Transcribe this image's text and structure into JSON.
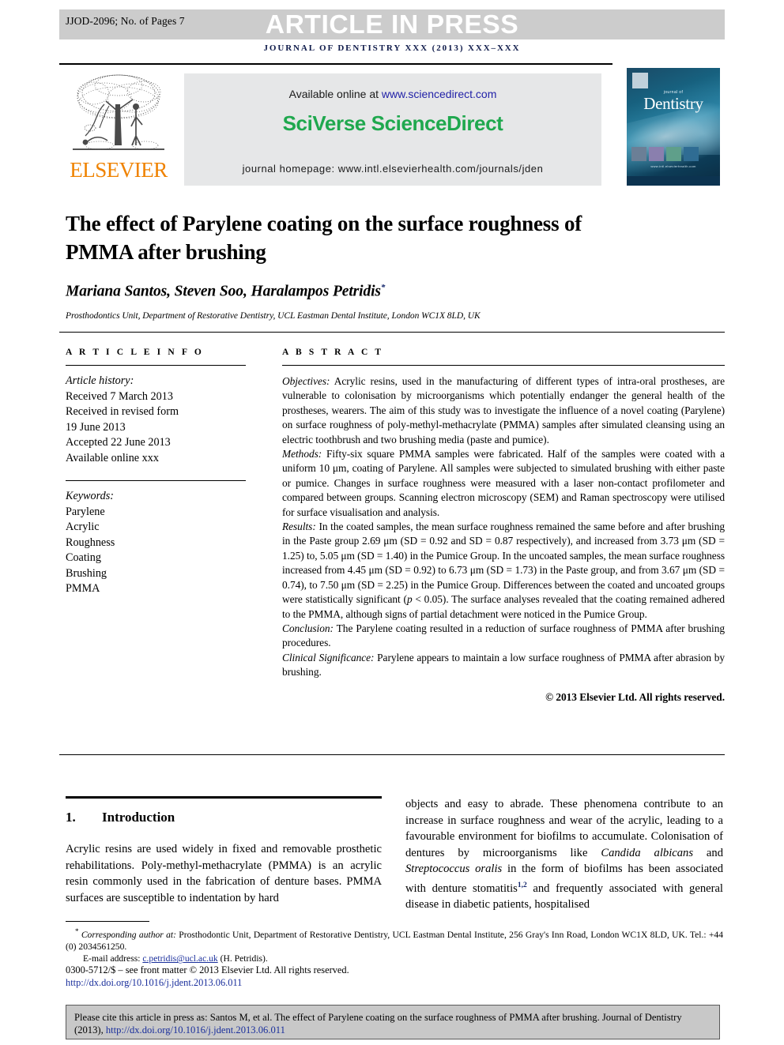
{
  "banner": {
    "manuscript_id": "JJOD-2096; No. of Pages 7",
    "press_label": "ARTICLE IN PRESS"
  },
  "journal_header": {
    "line": "journal of dentistry xxx (2013) xxx–xxx"
  },
  "masthead": {
    "publisher_name": "ELSEVIER",
    "available_prefix": "Available online at ",
    "available_url": "www.sciencedirect.com",
    "brand": "SciVerse ScienceDirect",
    "homepage": "journal homepage: www.intl.elsevierhealth.com/journals/jden",
    "cover": {
      "kicker": "journal of",
      "title": "Dentistry",
      "footer": "www.intl.elsevierhealth.com"
    }
  },
  "article": {
    "title": "The effect of Parylene coating on the surface roughness of PMMA after brushing",
    "authors": "Mariana Santos, Steven Soo, Haralampos Petridis",
    "corresponding_marker": "*",
    "affiliation": "Prosthodontics Unit, Department of Restorative Dentistry, UCL Eastman Dental Institute, London WC1X 8LD, UK"
  },
  "article_info": {
    "heading": "A R T I C L E  I N F O",
    "history_label": "Article history:",
    "history": [
      "Received 7 March 2013",
      "Received in revised form",
      "19 June 2013",
      "Accepted 22 June 2013",
      "Available online xxx"
    ],
    "keywords_label": "Keywords:",
    "keywords": [
      "Parylene",
      "Acrylic",
      "Roughness",
      "Coating",
      "Brushing",
      "PMMA"
    ]
  },
  "abstract": {
    "heading": "A B S T R A C T",
    "objectives_label": "Objectives:",
    "objectives_text": " Acrylic resins, used in the manufacturing of different types of intra-oral prostheses, are vulnerable to colonisation by microorganisms which potentially endanger the general health of the prostheses, wearers. The aim of this study was to investigate the influence of a novel coating (Parylene) on surface roughness of poly-methyl-methacrylate (PMMA) samples after simulated cleansing using an electric toothbrush and two brushing media (paste and pumice).",
    "methods_label": "Methods:",
    "methods_text": " Fifty-six square PMMA samples were fabricated. Half of the samples were coated with a uniform 10 μm, coating of Parylene. All samples were subjected to simulated brushing with either paste or pumice. Changes in surface roughness were measured with a laser non-contact profilometer and compared between groups. Scanning electron microscopy (SEM) and Raman spectroscopy were utilised for surface visualisation and analysis.",
    "results_label": "Results:",
    "results_text": " In the coated samples, the mean surface roughness remained the same before and after brushing in the Paste group 2.69 μm (SD = 0.92 and SD = 0.87 respectively), and increased from 3.73 μm (SD = 1.25) to, 5.05 μm (SD = 1.40) in the Pumice Group. In the uncoated samples, the mean surface roughness increased from 4.45 μm (SD = 0.92) to 6.73 μm (SD = 1.73) in the Paste group, and from 3.67 μm (SD = 0.74), to 7.50 μm (SD = 2.25) in the Pumice Group. Differences between the coated and uncoated groups were statistically significant (",
    "results_p_italic": "p",
    "results_p_rest": " < 0.05). The surface analyses revealed that the coating remained adhered to the PMMA, although signs of partial detachment were noticed in the Pumice Group.",
    "conclusion_label": "Conclusion:",
    "conclusion_text": " The Parylene coating resulted in a reduction of surface roughness of PMMA after brushing procedures.",
    "significance_label": "Clinical Significance:",
    "significance_text": " Parylene appears to maintain a low surface roughness of PMMA after abrasion by brushing.",
    "copyright": "© 2013 Elsevier Ltd. All rights reserved."
  },
  "body": {
    "section_number": "1.",
    "section_title": "Introduction",
    "left_paragraph": "Acrylic resins are used widely in fixed and removable prosthetic rehabilitations. Poly-methyl-methacrylate (PMMA) is an acrylic resin commonly used in the fabrication of denture bases. PMMA surfaces are susceptible to indentation by hard",
    "right_part1": "objects and easy to abrade. These phenomena contribute to an increase in surface roughness and wear of the acrylic, leading to a favourable environment for biofilms to accumulate. Colonisation of dentures by microorganisms like ",
    "right_italic1": "Candida albicans",
    "right_part2": " and ",
    "right_italic2": "Streptococcus oralis",
    "right_part3": " in the form of biofilms has been associated with denture stomatitis",
    "right_ref": "1,2",
    "right_part4": " and frequently associated with general disease in diabetic patients, hospitalised"
  },
  "footnote": {
    "marker": "*",
    "corresponding_label": "Corresponding author at:",
    "corresponding_text": " Prosthodontic Unit, Department of Restorative Dentistry, UCL Eastman Dental Institute, 256 Gray's Inn Road, London WC1X 8LD, UK. Tel.: +44 (0) 2034561250.",
    "email_label": "E-mail address:",
    "email": "c.petridis@ucl.ac.uk",
    "email_suffix": " (H. Petridis).",
    "issn_line": "0300-5712/$ – see front matter © 2013 Elsevier Ltd. All rights reserved.",
    "doi": "http://dx.doi.org/10.1016/j.jdent.2013.06.011"
  },
  "cite_box": {
    "text": "Please cite this article in press as: Santos M, et al. The effect of Parylene coating on the surface roughness of PMMA after brushing. Journal of Dentistry (2013), ",
    "doi": "http://dx.doi.org/10.1016/j.jdent.2013.06.011"
  },
  "colors": {
    "banner_bg": "#cccccc",
    "journal_navy": "#0e1a4a",
    "sciencedirect_green": "#1fa84e",
    "elsevier_orange": "#ef8200",
    "link_blue": "#1a2f9c",
    "cite_box_bg": "#c8c8c8"
  }
}
